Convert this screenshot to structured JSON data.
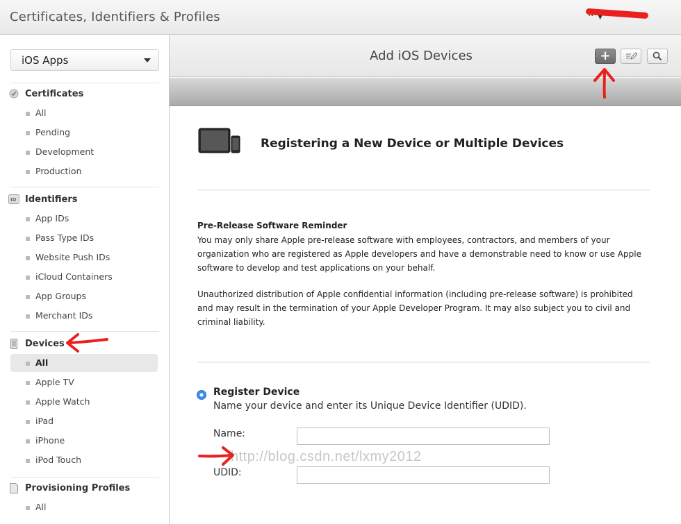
{
  "app": {
    "title": "Certificates, Identifiers & Profiles",
    "account_visible": "··"
  },
  "sidebar": {
    "platform": "iOS Apps",
    "sections": {
      "certificates": {
        "label": "Certificates",
        "icon": "certificate-icon",
        "items": [
          "All",
          "Pending",
          "Development",
          "Production"
        ]
      },
      "identifiers": {
        "label": "Identifiers",
        "icon": "id-badge-icon",
        "items": [
          "App IDs",
          "Pass Type IDs",
          "Website Push IDs",
          "iCloud Containers",
          "App Groups",
          "Merchant IDs"
        ]
      },
      "devices": {
        "label": "Devices",
        "icon": "phone-icon",
        "items": [
          "All",
          "Apple TV",
          "Apple Watch",
          "iPad",
          "iPhone",
          "iPod Touch"
        ],
        "active_item": "All"
      },
      "profiles": {
        "label": "Provisioning Profiles",
        "icon": "document-icon",
        "items": [
          "All"
        ]
      }
    }
  },
  "header": {
    "title": "Add iOS Devices",
    "add_icon": "plus-icon",
    "edit_icon": "edit-icon",
    "search_icon": "search-icon"
  },
  "content": {
    "heading": "Registering a New Device or Multiple Devices",
    "reminder_title": "Pre-Release Software Reminder",
    "reminder_body": "You may only share Apple pre-release software with employees, contractors, and members of your organization who are registered as Apple developers and have a demonstrable need to know or use Apple software to develop and test applications on your behalf.",
    "warning_body": "Unauthorized distribution of Apple confidential information (including pre-release software) is prohibited and may result in the termination of your Apple Developer Program. It may also subject you to civil and criminal liability.",
    "register_device": {
      "label": "Register Device",
      "description": "Name your device and enter its Unique Device Identifier (UDID).",
      "selected": true
    },
    "fields": {
      "name_label": "Name:",
      "name_value": "",
      "udid_label": "UDID:",
      "udid_value": ""
    }
  },
  "watermark": "http://blog.csdn.net/lxmy2012",
  "colors": {
    "annotation_arrow": "#e8211f",
    "radio_selected": "#3f8ee8"
  }
}
